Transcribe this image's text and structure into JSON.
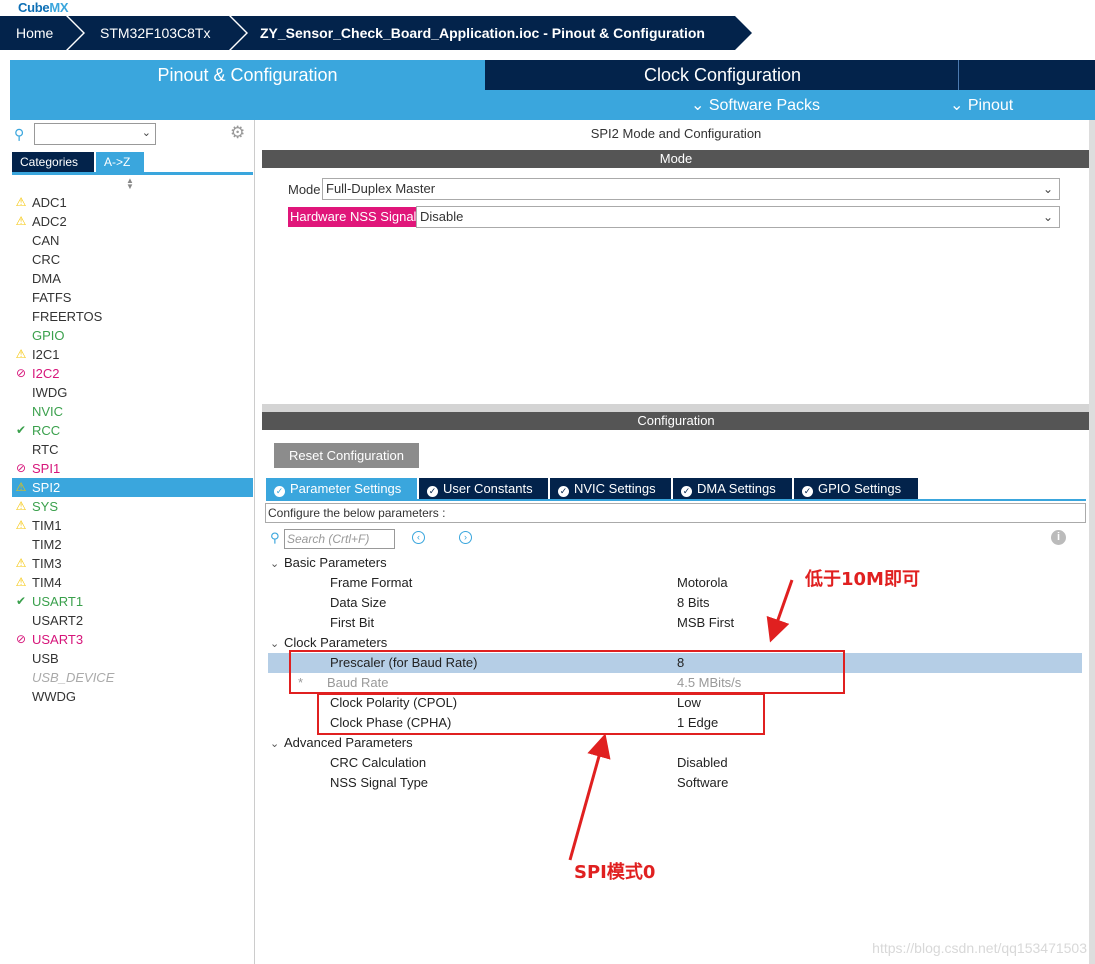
{
  "app": {
    "logo_main": "Cube",
    "logo_accent": "MX"
  },
  "breadcrumb": [
    "Home",
    "STM32F103C8Tx",
    "ZY_Sensor_Check_Board_Application.ioc - Pinout & Configuration"
  ],
  "top_tabs": [
    "Pinout & Configuration",
    "Clock Configuration",
    ""
  ],
  "sub_menu": {
    "software_packs": "Software Packs",
    "pinout": "Pinout"
  },
  "left": {
    "category_tabs": [
      "Categories",
      "A->Z"
    ],
    "items": [
      {
        "label": "ADC1",
        "status": "warning"
      },
      {
        "label": "ADC2",
        "status": "warning"
      },
      {
        "label": "CAN",
        "status": "none"
      },
      {
        "label": "CRC",
        "status": "none"
      },
      {
        "label": "DMA",
        "status": "none"
      },
      {
        "label": "FATFS",
        "status": "none"
      },
      {
        "label": "FREERTOS",
        "status": "none"
      },
      {
        "label": "GPIO",
        "status": "green-text"
      },
      {
        "label": "I2C1",
        "status": "warning"
      },
      {
        "label": "I2C2",
        "status": "blocked"
      },
      {
        "label": "IWDG",
        "status": "none"
      },
      {
        "label": "NVIC",
        "status": "green-text"
      },
      {
        "label": "RCC",
        "status": "ok"
      },
      {
        "label": "RTC",
        "status": "none"
      },
      {
        "label": "SPI1",
        "status": "blocked"
      },
      {
        "label": "SPI2",
        "status": "warning-selected"
      },
      {
        "label": "SYS",
        "status": "warning-green"
      },
      {
        "label": "TIM1",
        "status": "warning"
      },
      {
        "label": "TIM2",
        "status": "none"
      },
      {
        "label": "TIM3",
        "status": "warning"
      },
      {
        "label": "TIM4",
        "status": "warning"
      },
      {
        "label": "USART1",
        "status": "ok"
      },
      {
        "label": "USART2",
        "status": "none"
      },
      {
        "label": "USART3",
        "status": "blocked"
      },
      {
        "label": "USB",
        "status": "none"
      },
      {
        "label": "USB_DEVICE",
        "status": "disabled"
      },
      {
        "label": "WWDG",
        "status": "none"
      }
    ]
  },
  "right": {
    "title": "SPI2 Mode and Configuration",
    "mode_header": "Mode",
    "mode_label": "Mode",
    "mode_value": "Full-Duplex Master",
    "nss_label": "Hardware NSS Signal",
    "nss_value": "Disable",
    "config_header": "Configuration",
    "reset_button": "Reset Configuration",
    "param_tabs": [
      "Parameter Settings",
      "User Constants",
      "NVIC Settings",
      "DMA Settings",
      "GPIO Settings"
    ],
    "info_text": "Configure the below parameters :",
    "search_placeholder": "Search (Crtl+F)",
    "groups": [
      {
        "label": "Basic Parameters",
        "rows": [
          {
            "name": "Frame Format",
            "value": "Motorola"
          },
          {
            "name": "Data Size",
            "value": "8 Bits"
          },
          {
            "name": "First Bit",
            "value": "MSB First"
          }
        ]
      },
      {
        "label": "Clock Parameters",
        "rows": [
          {
            "name": "Prescaler (for Baud Rate)",
            "value": "8"
          },
          {
            "name": "Baud Rate",
            "value": "4.5 MBits/s"
          },
          {
            "name": "Clock Polarity (CPOL)",
            "value": "Low"
          },
          {
            "name": "Clock Phase (CPHA)",
            "value": "1 Edge"
          }
        ]
      },
      {
        "label": "Advanced Parameters",
        "rows": [
          {
            "name": "CRC Calculation",
            "value": "Disabled"
          },
          {
            "name": "NSS Signal Type",
            "value": "Software"
          }
        ]
      }
    ]
  },
  "annotations": {
    "top": "低于10M即可",
    "bottom": "SPI模式0",
    "baud_rate_star": "*"
  },
  "watermark": "https://blog.csdn.net/qq153471503"
}
